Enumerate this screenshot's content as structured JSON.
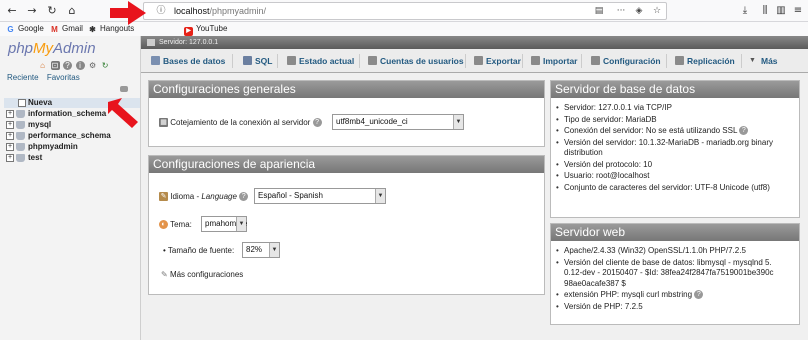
{
  "browser": {
    "url_host": "localhost",
    "url_path": "/phpmyadmin/",
    "bookmarks": [
      {
        "label": "Google",
        "icon": "google-icon"
      },
      {
        "label": "Gmail",
        "icon": "gmail-icon"
      },
      {
        "label": "Hangouts",
        "icon": "hangouts-icon"
      },
      {
        "label": "YouTube",
        "icon": "youtube-icon"
      }
    ]
  },
  "sidebar": {
    "logo_php": "php",
    "logo_my": "My",
    "logo_admin": "Admin",
    "tab_recent": "Reciente",
    "tab_favorites": "Favoritas",
    "tree": [
      {
        "label": "Nueva"
      },
      {
        "label": "information_schema"
      },
      {
        "label": "mysql"
      },
      {
        "label": "performance_schema"
      },
      {
        "label": "phpmyadmin"
      },
      {
        "label": "test"
      }
    ]
  },
  "header": {
    "server_label": "Servidor: 127.0.0.1"
  },
  "tabs": [
    {
      "label": "Bases de datos",
      "color": "#7a8fb0"
    },
    {
      "label": "SQL",
      "color": "#6b7fa0"
    },
    {
      "label": "Estado actual",
      "color": "#8a8a8a"
    },
    {
      "label": "Cuentas de usuarios",
      "color": "#8a8a8a"
    },
    {
      "label": "Exportar",
      "color": "#8a8a8a"
    },
    {
      "label": "Importar",
      "color": "#8a8a8a"
    },
    {
      "label": "Configuración",
      "color": "#8a8a8a"
    },
    {
      "label": "Replicación",
      "color": "#8a8a8a"
    },
    {
      "label": "Más",
      "color": "#555"
    }
  ],
  "general": {
    "title": "Configuraciones generales",
    "collation_label": "Cotejamiento de la conexión al servidor",
    "collation_value": "utf8mb4_unicode_ci"
  },
  "appearance": {
    "title": "Configuraciones de apariencia",
    "language_label_prefix": "Idioma - ",
    "language_label_en": "Language",
    "language_value": "Español - Spanish",
    "theme_label": "Tema:",
    "theme_value": "pmahomme",
    "fontsize_label": "Tamaño de fuente:",
    "fontsize_value": "82%",
    "more_settings": "Más configuraciones"
  },
  "db_server": {
    "title": "Servidor de base de datos",
    "items": [
      "Servidor: 127.0.0.1 via TCP/IP",
      "Tipo de servidor: MariaDB",
      "Conexión del servidor: No se está utilizando SSL",
      "Versión del servidor: 10.1.32-MariaDB - mariadb.org binary distribution",
      "Versión del protocolo: 10",
      "Usuario: root@localhost",
      "Conjunto de caracteres del servidor: UTF-8 Unicode (utf8)"
    ]
  },
  "web_server": {
    "title": "Servidor web",
    "items": [
      "Apache/2.4.33 (Win32) OpenSSL/1.1.0h PHP/7.2.5",
      "Versión del cliente de base de datos: libmysql - mysqlnd 5.0.12-dev - 20150407 - $Id: 38fea24f2847fa7519001be390c98ae0acafe387 $",
      "extensión PHP: mysqli curl mbstring",
      "Versión de PHP: 7.2.5"
    ]
  }
}
